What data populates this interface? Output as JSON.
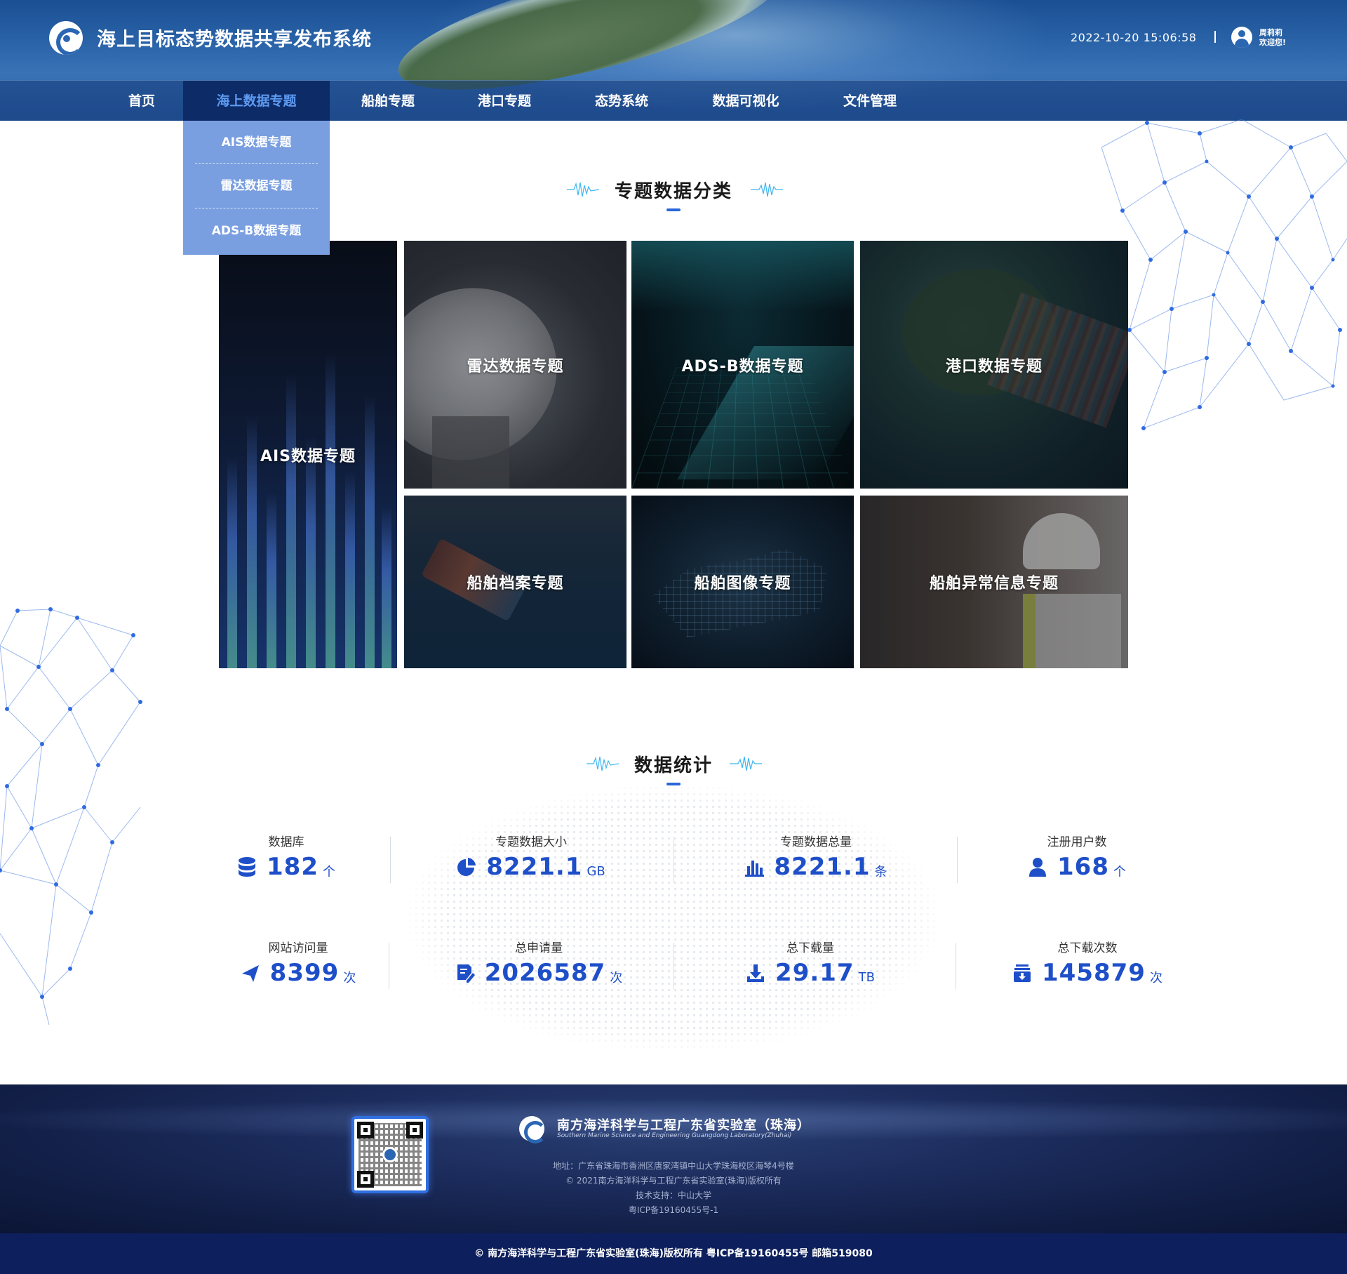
{
  "header": {
    "app_title": "海上目标态势数据共享发布系统",
    "datetime": "2022-10-20 15:06:58",
    "user_name": "周莉莉",
    "user_greeting": "欢迎您!"
  },
  "nav": {
    "items": [
      {
        "label": "首页",
        "active": false
      },
      {
        "label": "海上数据专题",
        "active": true
      },
      {
        "label": "船舶专题",
        "active": false
      },
      {
        "label": "港口专题",
        "active": false
      },
      {
        "label": "态势系统",
        "active": false
      },
      {
        "label": "数据可视化",
        "active": false
      },
      {
        "label": "文件管理",
        "active": false
      }
    ],
    "dropdown": [
      "AIS数据专题",
      "雷达数据专题",
      "ADS-B数据专题"
    ]
  },
  "topics": {
    "title": "专题数据分类",
    "tiles": [
      {
        "label": "AIS数据专题"
      },
      {
        "label": "雷达数据专题"
      },
      {
        "label": "ADS-B数据专题"
      },
      {
        "label": "港口数据专题"
      },
      {
        "label": "船舶档案专题"
      },
      {
        "label": "船舶图像专题"
      },
      {
        "label": "船舶异常信息专题"
      }
    ]
  },
  "stats": {
    "title": "数据统计",
    "items": [
      {
        "label": "数据库",
        "value": "182",
        "unit": "个",
        "icon": "database-icon"
      },
      {
        "label": "专题数据大小",
        "value": "8221.1",
        "unit": "GB",
        "icon": "pie-chart-icon"
      },
      {
        "label": "专题数据总量",
        "value": "8221.1",
        "unit": "条",
        "icon": "bar-chart-icon"
      },
      {
        "label": "注册用户数",
        "value": "168",
        "unit": "个",
        "icon": "user-icon"
      },
      {
        "label": "网站访问量",
        "value": "8399",
        "unit": "次",
        "icon": "send-icon"
      },
      {
        "label": "总申请量",
        "value": "2026587",
        "unit": "次",
        "icon": "edit-doc-icon"
      },
      {
        "label": "总下载量",
        "value": "29.17",
        "unit": "TB",
        "icon": "download-icon"
      },
      {
        "label": "总下载次数",
        "value": "145879",
        "unit": "次",
        "icon": "download-box-icon"
      }
    ]
  },
  "footer": {
    "org_name": "南方海洋科学与工程广东省实验室（珠海）",
    "org_name_en": "Southern Marine Science and Engineering Guangdong Laboratory(Zhuhai)",
    "address": "地址：广东省珠海市香洲区唐家湾镇中山大学珠海校区海琴4号楼",
    "copyright": "© 2021南方海洋科学与工程广东省实验室(珠海)版权所有",
    "tech_support": "技术支持：中山大学",
    "icp": "粤ICP备19160455号-1",
    "bottom_bar": "© 南方海洋科学与工程广东省实验室(珠海)版权所有   粤ICP备19160455号   邮箱519080"
  },
  "colors": {
    "accent": "#1e4fc9",
    "nav_active_bg": "#0d2b67",
    "nav_active_text": "#5d9af0",
    "dropdown_bg": "#7a9fe0",
    "bottom_bar_bg": "#0d1f5c"
  }
}
